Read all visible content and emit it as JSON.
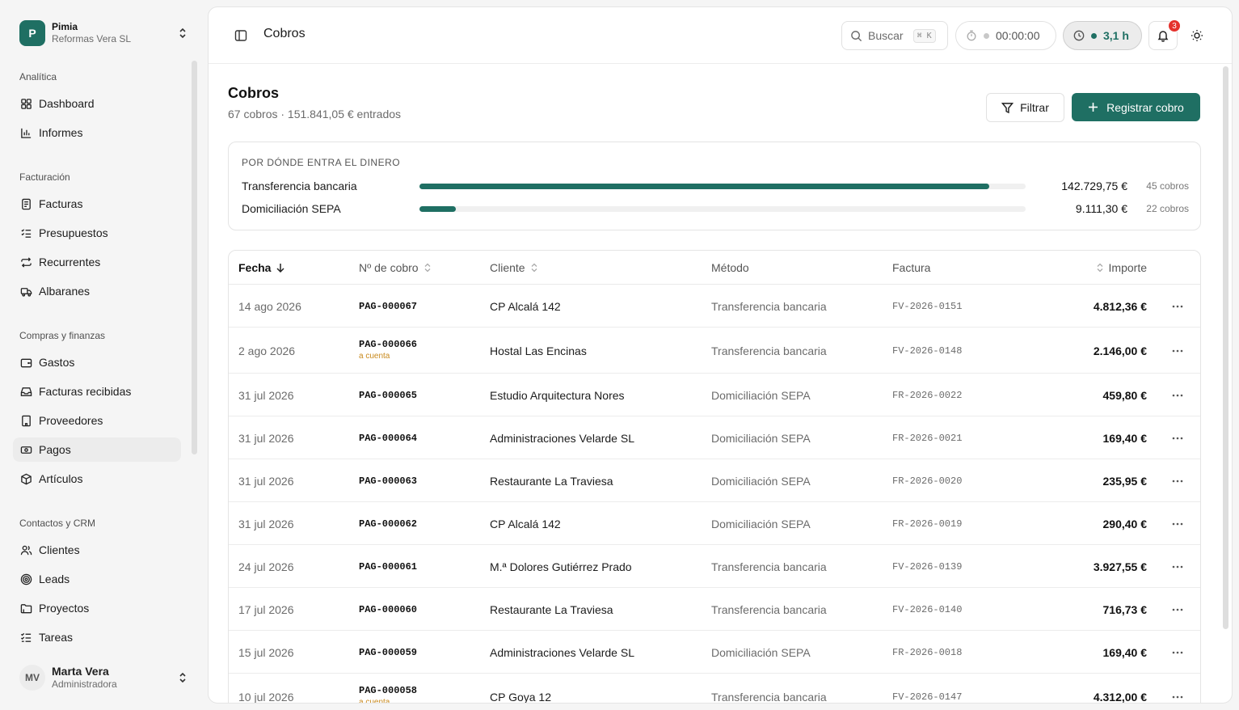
{
  "workspace": {
    "initial": "P",
    "name": "Pimia",
    "company": "Reformas Vera SL"
  },
  "sidebar": {
    "sections": [
      {
        "title": "Analítica",
        "items": [
          {
            "label": "Dashboard",
            "icon": "dashboard-icon"
          },
          {
            "label": "Informes",
            "icon": "bar-chart-icon"
          }
        ]
      },
      {
        "title": "Facturación",
        "items": [
          {
            "label": "Facturas",
            "icon": "invoice-icon"
          },
          {
            "label": "Presupuestos",
            "icon": "checklist-icon"
          },
          {
            "label": "Recurrentes",
            "icon": "repeat-icon"
          },
          {
            "label": "Albaranes",
            "icon": "truck-icon"
          }
        ]
      },
      {
        "title": "Compras y finanzas",
        "items": [
          {
            "label": "Gastos",
            "icon": "wallet-icon"
          },
          {
            "label": "Facturas recibidas",
            "icon": "inbox-icon"
          },
          {
            "label": "Proveedores",
            "icon": "building-icon"
          },
          {
            "label": "Pagos",
            "icon": "banknote-icon",
            "active": true
          },
          {
            "label": "Artículos",
            "icon": "package-icon"
          }
        ]
      },
      {
        "title": "Contactos y CRM",
        "items": [
          {
            "label": "Clientes",
            "icon": "users-icon"
          },
          {
            "label": "Leads",
            "icon": "target-icon"
          },
          {
            "label": "Proyectos",
            "icon": "folder-icon"
          },
          {
            "label": "Tareas",
            "icon": "tasks-icon"
          }
        ]
      }
    ]
  },
  "user": {
    "initials": "MV",
    "name": "Marta Vera",
    "role": "Administradora"
  },
  "topbar": {
    "title": "Cobros",
    "search_label": "Buscar",
    "search_shortcut": "⌘ K",
    "timer": "00:00:00",
    "hours": "3,1 h",
    "notifications": "3"
  },
  "page": {
    "title": "Cobros",
    "subtitle": "67 cobros · 151.841,05 € entrados",
    "filter_label": "Filtrar",
    "primary_label": "Registrar cobro"
  },
  "money": {
    "title": "POR DÓNDE ENTRA EL DINERO",
    "rows": [
      {
        "label": "Transferencia bancaria",
        "amount": "142.729,75 €",
        "count": "45 cobros",
        "fraction": 0.94
      },
      {
        "label": "Domiciliación SEPA",
        "amount": "9.111,30 €",
        "count": "22 cobros",
        "fraction": 0.06
      }
    ]
  },
  "table": {
    "headers": {
      "fecha": "Fecha",
      "numero": "Nº de cobro",
      "cliente": "Cliente",
      "metodo": "Método",
      "factura": "Factura",
      "importe": "Importe"
    },
    "rows": [
      {
        "fecha": "14 ago 2026",
        "numero": "PAG-000067",
        "tag": "",
        "cliente": "CP Alcalá 142",
        "metodo": "Transferencia bancaria",
        "factura": "FV-2026-0151",
        "importe": "4.812,36 €"
      },
      {
        "fecha": "2 ago 2026",
        "numero": "PAG-000066",
        "tag": "a cuenta",
        "cliente": "Hostal Las Encinas",
        "metodo": "Transferencia bancaria",
        "factura": "FV-2026-0148",
        "importe": "2.146,00 €"
      },
      {
        "fecha": "31 jul 2026",
        "numero": "PAG-000065",
        "tag": "",
        "cliente": "Estudio Arquitectura Nores",
        "metodo": "Domiciliación SEPA",
        "factura": "FR-2026-0022",
        "importe": "459,80 €"
      },
      {
        "fecha": "31 jul 2026",
        "numero": "PAG-000064",
        "tag": "",
        "cliente": "Administraciones Velarde SL",
        "metodo": "Domiciliación SEPA",
        "factura": "FR-2026-0021",
        "importe": "169,40 €"
      },
      {
        "fecha": "31 jul 2026",
        "numero": "PAG-000063",
        "tag": "",
        "cliente": "Restaurante La Traviesa",
        "metodo": "Domiciliación SEPA",
        "factura": "FR-2026-0020",
        "importe": "235,95 €"
      },
      {
        "fecha": "31 jul 2026",
        "numero": "PAG-000062",
        "tag": "",
        "cliente": "CP Alcalá 142",
        "metodo": "Domiciliación SEPA",
        "factura": "FR-2026-0019",
        "importe": "290,40 €"
      },
      {
        "fecha": "24 jul 2026",
        "numero": "PAG-000061",
        "tag": "",
        "cliente": "M.ª Dolores Gutiérrez Prado",
        "metodo": "Transferencia bancaria",
        "factura": "FV-2026-0139",
        "importe": "3.927,55 €"
      },
      {
        "fecha": "17 jul 2026",
        "numero": "PAG-000060",
        "tag": "",
        "cliente": "Restaurante La Traviesa",
        "metodo": "Transferencia bancaria",
        "factura": "FV-2026-0140",
        "importe": "716,73 €"
      },
      {
        "fecha": "15 jul 2026",
        "numero": "PAG-000059",
        "tag": "",
        "cliente": "Administraciones Velarde SL",
        "metodo": "Domiciliación SEPA",
        "factura": "FR-2026-0018",
        "importe": "169,40 €"
      },
      {
        "fecha": "10 jul 2026",
        "numero": "PAG-000058",
        "tag": "a cuenta",
        "cliente": "CP Goya 12",
        "metodo": "Transferencia bancaria",
        "factura": "FV-2026-0147",
        "importe": "4.312,00 €"
      }
    ]
  },
  "colors": {
    "accent": "#1f6f63",
    "badge": "#e5322d",
    "tag": "#c98a1e"
  }
}
